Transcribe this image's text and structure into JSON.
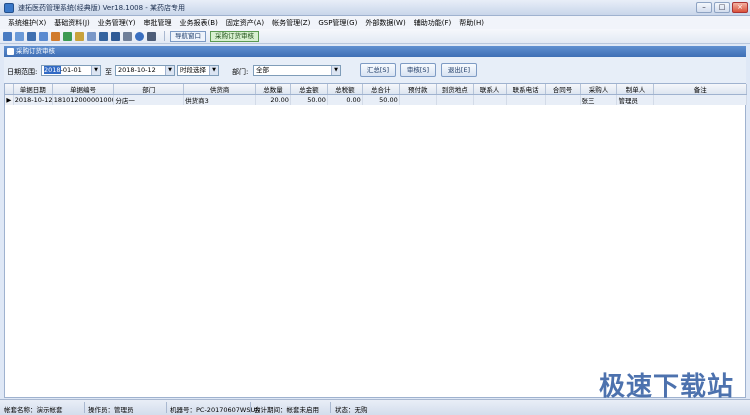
{
  "window": {
    "title": "速拓医药管理系统(经典版) Ver18.1008  - 某药店专用"
  },
  "menu": [
    "系统维护(X)",
    "基础资料(J)",
    "业务管理(Y)",
    "审批管理",
    "业务报表(B)",
    "固定资产(A)",
    "帐务管理(Z)",
    "GSP管理(G)",
    "外部数据(W)",
    "辅助功能(F)",
    "帮助(H)"
  ],
  "toolbar": {
    "nav_window": "导航窗口",
    "po_review": "采购订货审核"
  },
  "panel": {
    "title": "采购订货审核"
  },
  "filter": {
    "date_label": "日期范围:",
    "date_from_year": "2018",
    "date_from_rest": "-01-01",
    "to_label": "至",
    "date_to": "2018-10-12",
    "time_select": "时段选择",
    "dept_label": "部门:",
    "dept_value": "全部",
    "summary_button": "汇总[S]",
    "approve_button": "审核[S]",
    "exit_button": "退出[E]"
  },
  "table": {
    "columns": [
      "单据日期",
      "单据编号",
      "部门",
      "供货商",
      "总数量",
      "总金额",
      "总税额",
      "总合计",
      "预付款",
      "到货地点",
      "联系人",
      "联系电话",
      "合同号",
      "采购人",
      "制单人",
      "备注"
    ],
    "rows": [
      [
        "2018-10-12",
        "1810120000010001",
        "分店一",
        "供货商3",
        "20.00",
        "50.00",
        "0.00",
        "50.00",
        "",
        "",
        "",
        "",
        "",
        "张三",
        "管理员",
        ""
      ]
    ]
  },
  "status": {
    "account": "帐套名称：演示帐套",
    "operator": "操作员：管理员",
    "machine": "机器号：PC-20170607WSUN",
    "period": "会计期间：帐套未启用",
    "state": "状态：无购"
  },
  "watermark": "极速下载站",
  "colors": {
    "accent": "#3e6fb5",
    "selection": "#316ac5"
  }
}
